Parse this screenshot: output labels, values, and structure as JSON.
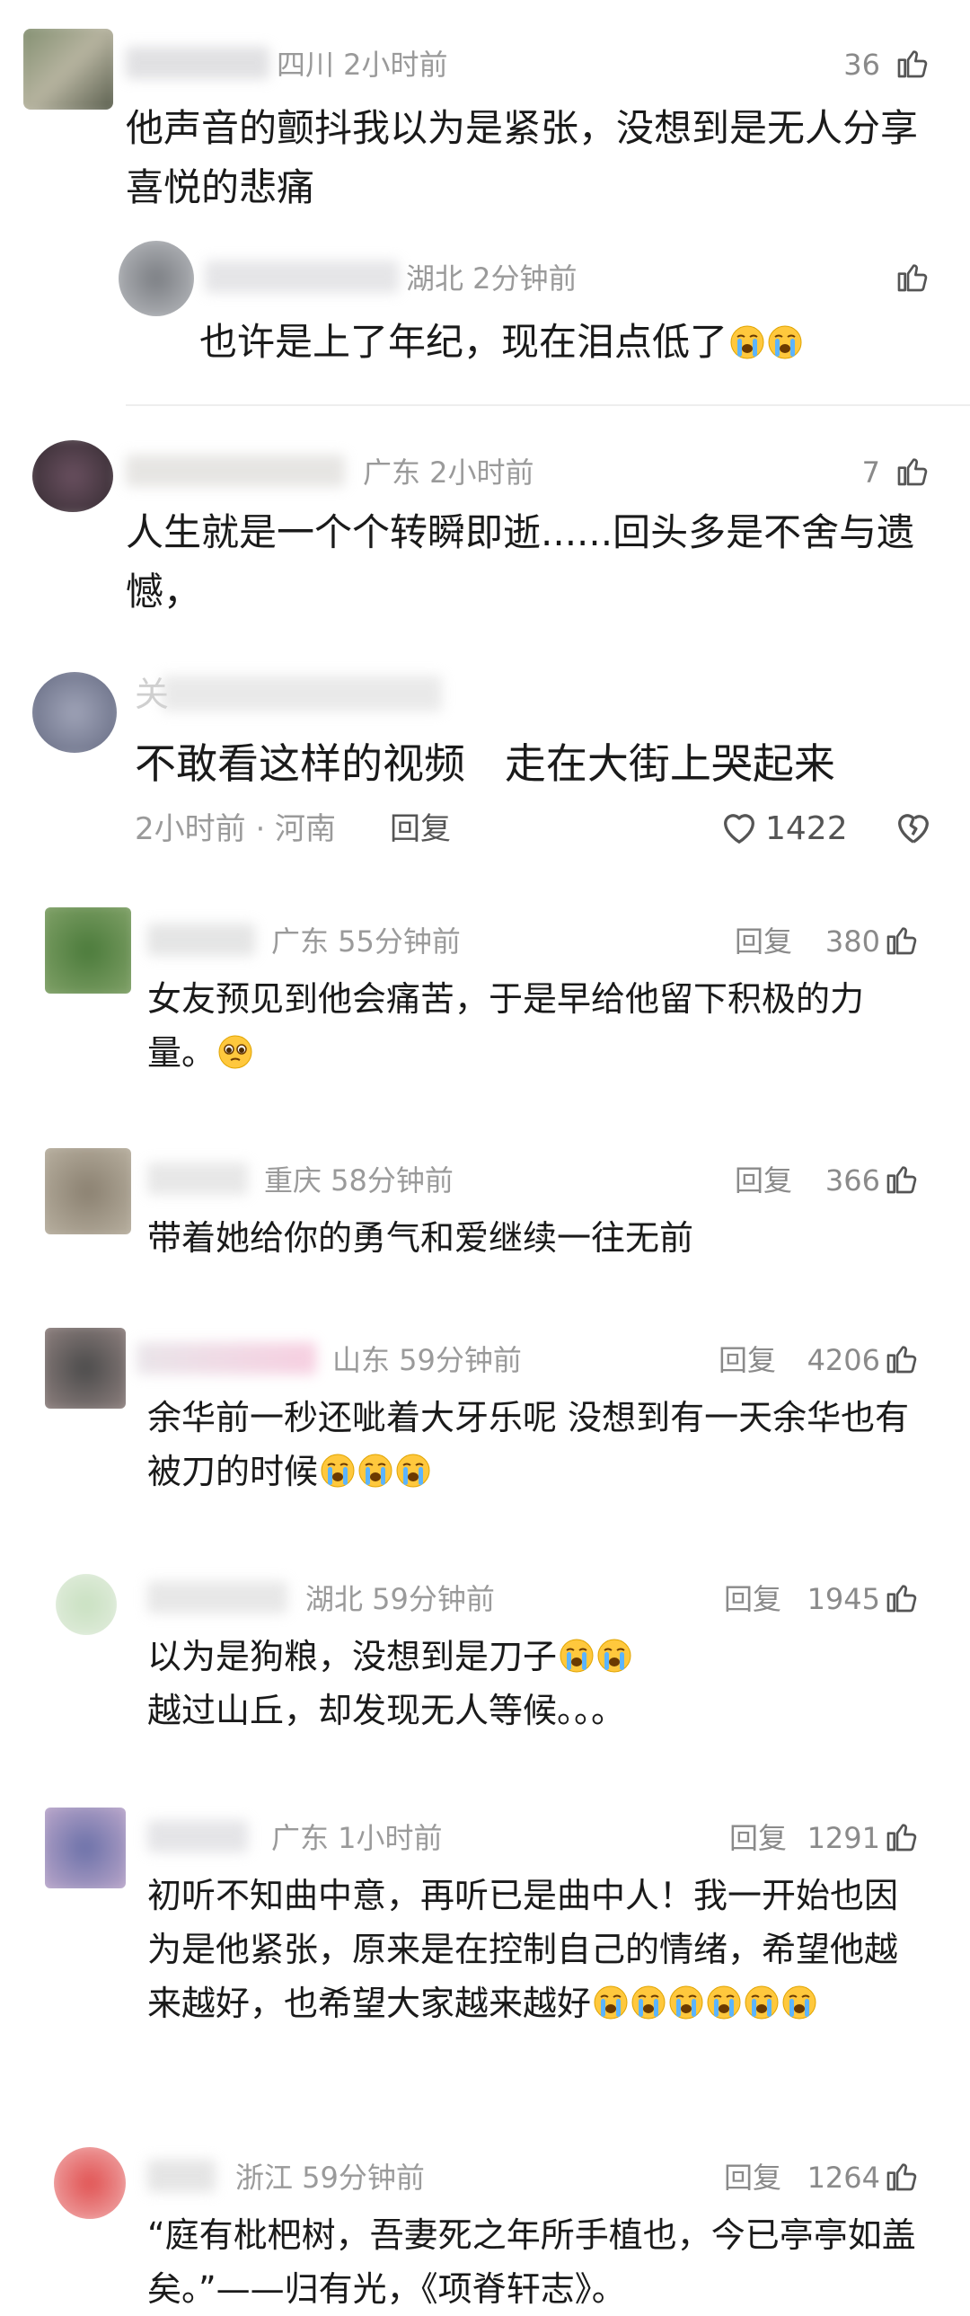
{
  "colors": {
    "meta": "#9a9a9a",
    "text": "#1a1a1a",
    "emoji": "#ffc83d"
  },
  "comments": [
    {
      "location_time": "四川 2小时前",
      "likes": "36",
      "text": "他声音的颤抖我以为是紧张，没想到是无人分享喜悦的悲痛"
    },
    {
      "location_time": "湖北 2分钟前",
      "likes": "",
      "text": "也许是上了年纪，现在泪点低了"
    },
    {
      "location_time": "广东 2小时前",
      "likes": "7",
      "text": "人生就是一个个转瞬即逝......回头多是不舍与遗憾，"
    },
    {
      "name_fragment": "关",
      "text": "不敢看这样的视频   走在大街上哭起来",
      "time_location": "2小时前 · 河南",
      "reply": "回复",
      "likes": "1422"
    },
    {
      "location_time": "广东 55分钟前",
      "reply": "回复",
      "likes": "380",
      "text": "女友预见到他会痛苦，于是早给他留下积极的力量。"
    },
    {
      "location_time": "重庆 58分钟前",
      "reply": "回复",
      "likes": "366",
      "text": "带着她给你的勇气和爱继续一往无前"
    },
    {
      "location_time": "山东 59分钟前",
      "reply": "回复",
      "likes": "4206",
      "text": "余华前一秒还呲着大牙乐呢 没想到有一天余华也有被刀的时候"
    },
    {
      "location_time": "湖北 59分钟前",
      "reply": "回复",
      "likes": "1945",
      "text_line1": "以为是狗粮，没想到是刀子",
      "text_line2": "越过山丘，却发现无人等候。。。"
    },
    {
      "location_time": "广东 1小时前",
      "reply": "回复",
      "likes": "1291",
      "text": "初听不知曲中意，再听已是曲中人！我一开始也因为是他紧张，原来是在控制自己的情绪，希望他越来越好，也希望大家越来越好"
    },
    {
      "location_time": "浙江 59分钟前",
      "reply": "回复",
      "likes": "1264",
      "text": "“庭有枇杷树，吾妻死之年所手植也，今已亭亭如盖矣。”——归有光，《项脊轩志》。"
    }
  ]
}
